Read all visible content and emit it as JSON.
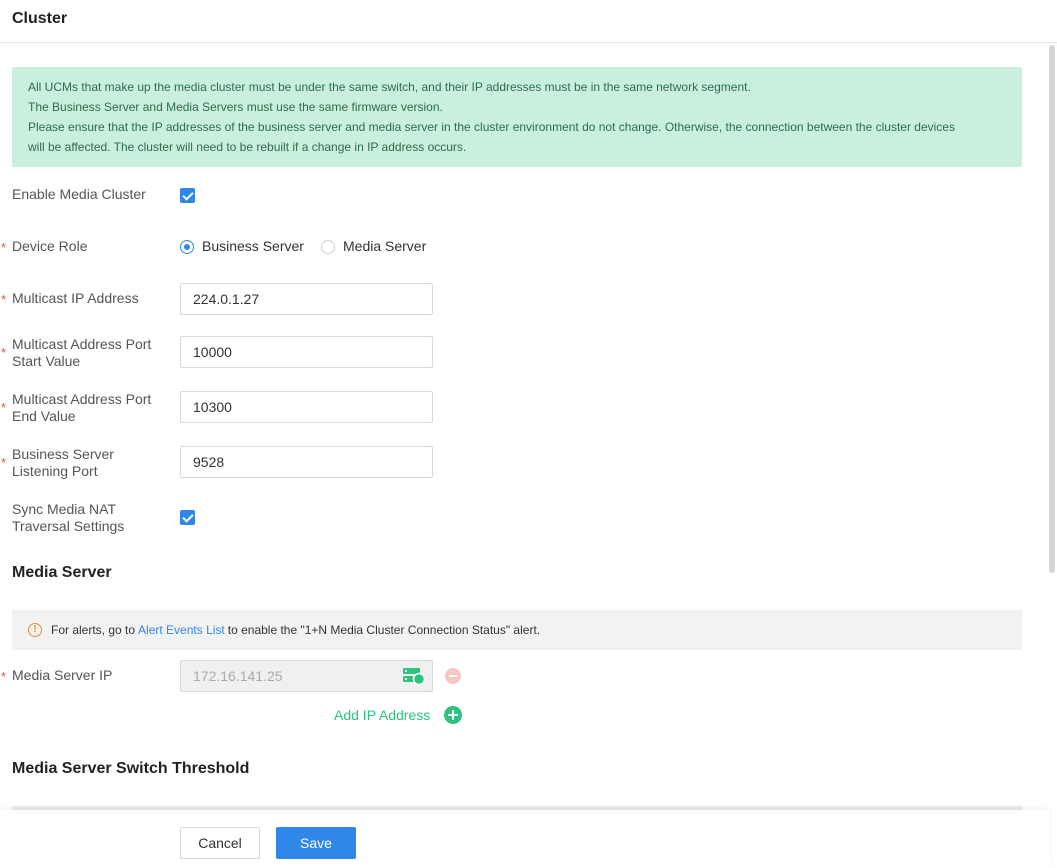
{
  "header": {
    "title": "Cluster"
  },
  "notice": {
    "lines": [
      "All UCMs that make up the media cluster must be under the same switch, and their IP addresses must be in the same network segment.",
      "The Business Server and Media Servers must use the same firmware version.",
      "Please ensure that the IP addresses of the business server and media server in the cluster environment do not change. Otherwise, the connection between the cluster devices",
      "will be affected. The cluster will need to be rebuilt if a change in IP address occurs."
    ]
  },
  "form": {
    "enable_media_cluster": {
      "label": "Enable Media Cluster",
      "checked": true
    },
    "device_role": {
      "label": "Device Role",
      "options": [
        "Business Server",
        "Media Server"
      ],
      "selected": "Business Server"
    },
    "multicast_ip": {
      "label": "Multicast IP Address",
      "value": "224.0.1.27"
    },
    "port_start": {
      "label_line1": "Multicast Address Port",
      "label_line2": "Start Value",
      "value": "10000"
    },
    "port_end": {
      "label_line1": "Multicast Address Port",
      "label_line2": "End Value",
      "value": "10300"
    },
    "listening_port": {
      "label_line1": "Business Server",
      "label_line2": "Listening Port",
      "value": "9528"
    },
    "sync_nat": {
      "label_line1": "Sync Media NAT",
      "label_line2": "Traversal Settings",
      "checked": true
    }
  },
  "media_server": {
    "title": "Media Server",
    "alert": {
      "icon": "!",
      "prefix": "For alerts, go to",
      "link": "Alert Events List",
      "suffix": "to enable the \"1+N Media Cluster Connection Status\" alert."
    },
    "ip_label": "Media Server IP",
    "ip_value": "172.16.141.25",
    "add_label": "Add IP Address"
  },
  "threshold": {
    "title": "Media Server Switch Threshold"
  },
  "footer": {
    "cancel_label": "Cancel",
    "save_label": "Save"
  },
  "required_mark": "*",
  "colors": {
    "primary": "#2f87e8",
    "success": "#2ec27e",
    "notice_bg": "#c9f0dd",
    "required": "#e34d4d",
    "warning": "#f0892f"
  }
}
